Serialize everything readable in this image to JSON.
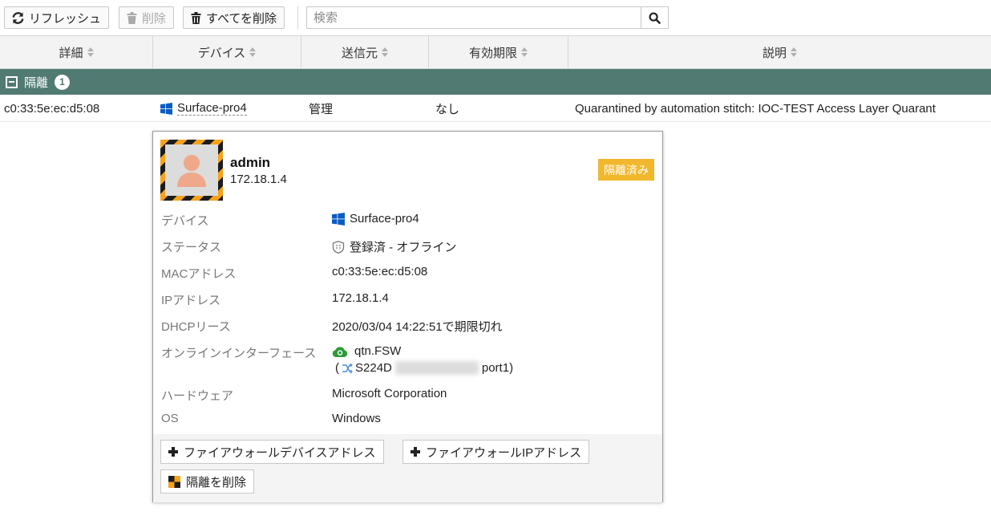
{
  "toolbar": {
    "refresh_label": "リフレッシュ",
    "delete_label": "削除",
    "delete_all_label": "すべてを削除",
    "search_placeholder": "検索"
  },
  "table": {
    "columns": [
      "詳細",
      "デバイス",
      "送信元",
      "有効期限",
      "説明"
    ],
    "group": {
      "label": "隔離",
      "count": "1"
    },
    "rows": [
      {
        "detail": "c0:33:5e:ec:d5:08",
        "device": "Surface-pro4",
        "source": "管理",
        "expiry": "なし",
        "description": "Quarantined by automation stitch: IOC-TEST Access Layer Quarant"
      }
    ]
  },
  "popup": {
    "user": "admin",
    "ip": "172.18.1.4",
    "badge": "隔離済み",
    "fields": {
      "device_label": "デバイス",
      "device_value": "Surface-pro4",
      "status_label": "ステータス",
      "status_value": "登録済 - オフライン",
      "mac_label": "MACアドレス",
      "mac_value": "c0:33:5e:ec:d5:08",
      "ip_label": "IPアドレス",
      "ip_value": "172.18.1.4",
      "dhcp_label": "DHCPリース",
      "dhcp_value": "2020/03/04 14:22:51で期限切れ",
      "iface_label": "オンラインインターフェース",
      "iface_value1": "qtn.FSW",
      "iface_open": "(",
      "iface_value2_prefix": "S224D",
      "iface_value2_suffix": "port1)",
      "hw_label": "ハードウェア",
      "hw_value": "Microsoft Corporation",
      "os_label": "OS",
      "os_value": "Windows"
    },
    "buttons": {
      "fw_device_address": "ファイアウォールデバイスアドレス",
      "fw_ip_address": "ファイアウォールIPアドレス",
      "remove_quarantine": "隔離を削除"
    }
  },
  "colors": {
    "group_bg": "#507a72",
    "badge_bg": "#f1b82d",
    "windows_blue": "#0a5bc4",
    "cloud_green": "#2f9a3a"
  }
}
